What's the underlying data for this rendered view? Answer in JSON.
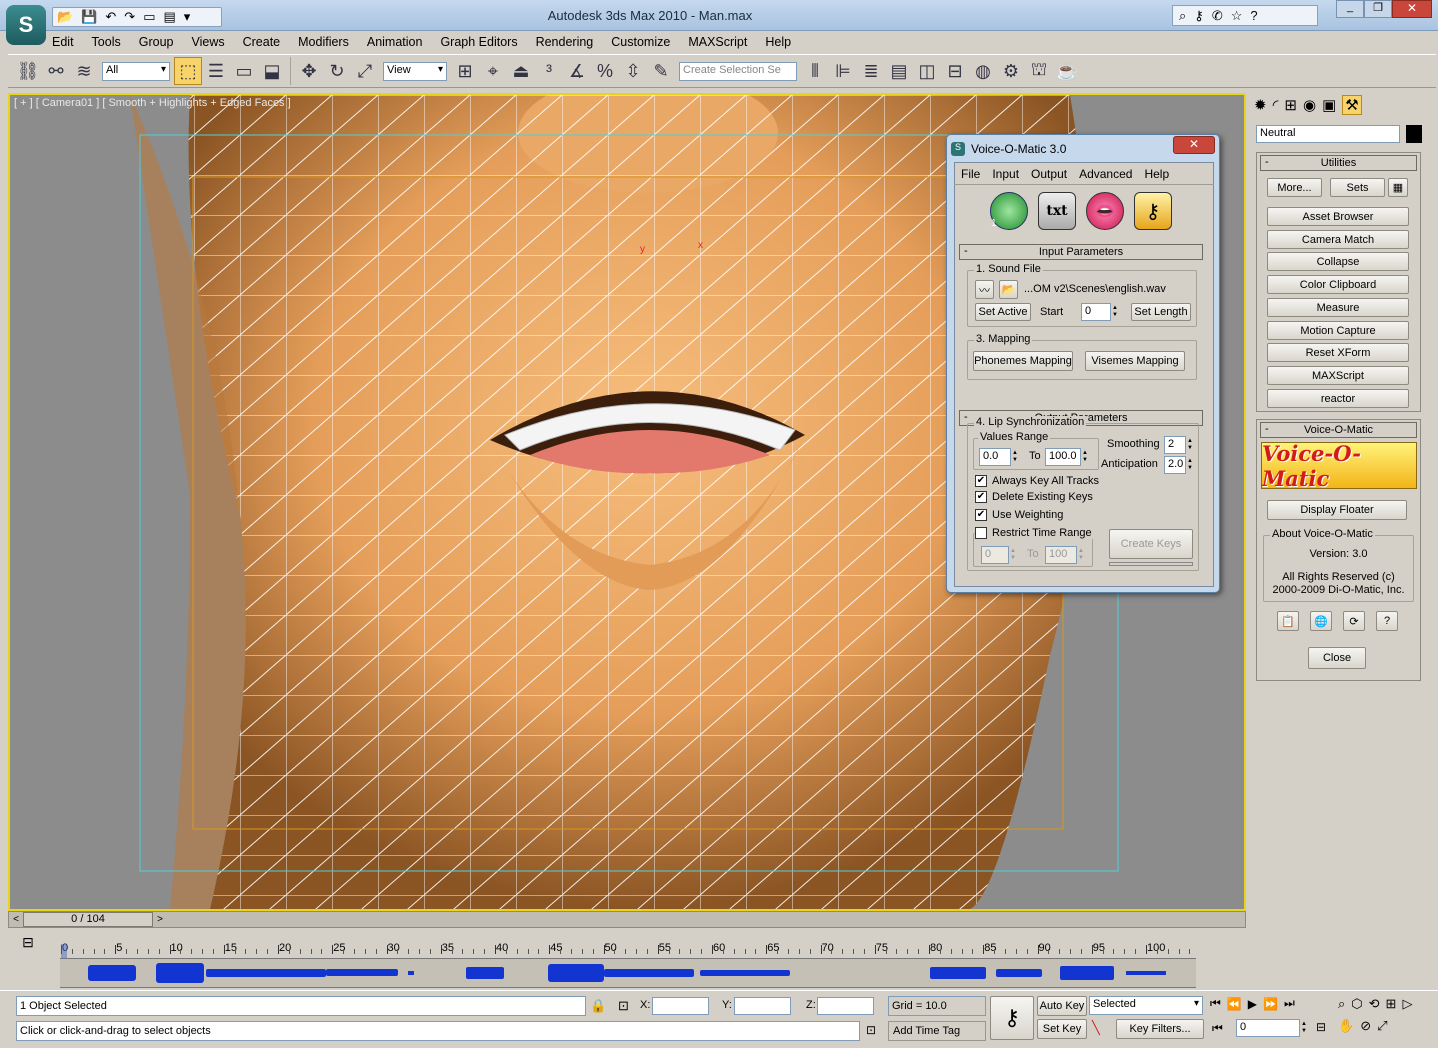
{
  "window": {
    "title": "Autodesk 3ds Max  2010   - Man.max"
  },
  "menu": [
    "Edit",
    "Tools",
    "Group",
    "Views",
    "Create",
    "Modifiers",
    "Animation",
    "Graph Editors",
    "Rendering",
    "Customize",
    "MAXScript",
    "Help"
  ],
  "toolbar": {
    "selection_filter": "All",
    "ref_coord": "View",
    "named_selection_placeholder": "Create Selection Se"
  },
  "viewport": {
    "label": "[ + ] [ Camera01 ] [ Smooth + Highlights + Edged Faces ]"
  },
  "command_panel": {
    "object_name": "Neutral",
    "utilities_title": "Utilities",
    "more_label": "More...",
    "sets_label": "Sets",
    "utilities": [
      "Asset Browser",
      "Camera Match",
      "Collapse",
      "Color Clipboard",
      "Measure",
      "Motion Capture",
      "Reset XForm",
      "MAXScript",
      "reactor"
    ],
    "vom_title": "Voice-O-Matic",
    "vom_logo": "Voice-O-Matic",
    "display_floater": "Display Floater",
    "about_title": "About Voice-O-Matic",
    "version": "Version: 3.0",
    "rights1": "All Rights Reserved (c)",
    "rights2": "2000-2009 Di-O-Matic, Inc.",
    "close_label": "Close"
  },
  "dialog": {
    "title": "Voice-O-Matic 3.0",
    "menu": [
      "File",
      "Input",
      "Output",
      "Advanced",
      "Help"
    ],
    "input_params": "Input Parameters",
    "sound_file_group": "1. Sound File",
    "sound_file": "...OM v2\\Scenes\\english.wav",
    "set_active": "Set Active",
    "start_label": "Start",
    "start_value": "0",
    "set_length": "Set Length",
    "mapping_group": "3. Mapping",
    "phonemes": "Phonemes Mapping",
    "visemes": "Visemes Mapping",
    "output_params": "Output Parameters",
    "lipsync_group": "4. Lip Synchronization",
    "values_range": "Values Range",
    "from_value": "0.0",
    "to_label": "To",
    "to_value": "100.0",
    "smoothing_label": "Smoothing",
    "smoothing_value": "2",
    "anticipation_label": "Anticipation",
    "anticipation_value": "2.0",
    "always_key": "Always Key All Tracks",
    "delete_keys": "Delete Existing Keys",
    "use_weighting": "Use Weighting",
    "restrict": "Restrict Time Range",
    "restrict_from": "0",
    "restrict_to": "100",
    "create_keys": "Create Keys"
  },
  "timeline": {
    "slider_label": "0 / 104",
    "ticks": [
      "0",
      "5",
      "10",
      "15",
      "20",
      "25",
      "30",
      "35",
      "40",
      "45",
      "50",
      "55",
      "60",
      "65",
      "70",
      "75",
      "80",
      "85",
      "90",
      "95",
      "100"
    ]
  },
  "status": {
    "selected": "1 Object Selected",
    "prompt": "Click or click-and-drag to select objects",
    "x_label": "X:",
    "y_label": "Y:",
    "z_label": "Z:",
    "grid": "Grid = 10.0",
    "add_time_tag": "Add Time Tag",
    "auto_key": "Auto Key",
    "set_key": "Set Key",
    "key_mode": "Selected",
    "key_filters": "Key Filters...",
    "frame": "0"
  }
}
